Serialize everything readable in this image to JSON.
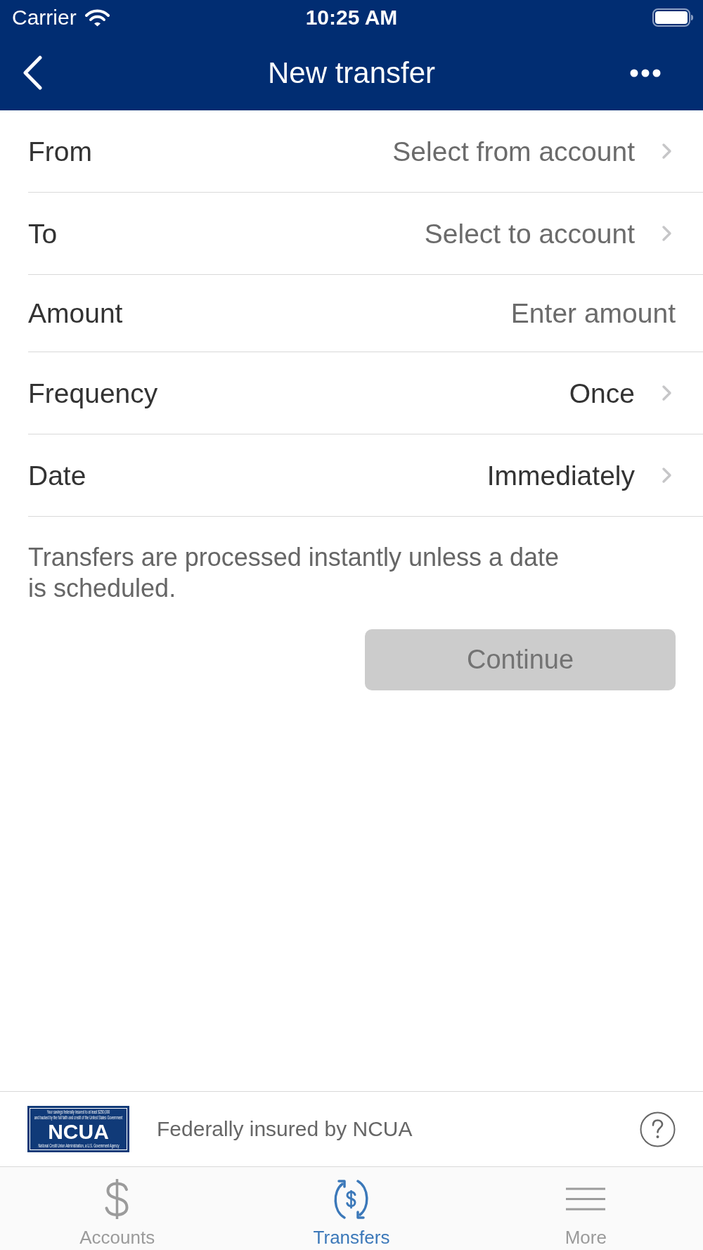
{
  "status_bar": {
    "carrier": "Carrier",
    "time": "10:25 AM"
  },
  "nav_bar": {
    "title": "New transfer"
  },
  "form": {
    "rows": [
      {
        "kind": "picker",
        "label": "From",
        "placeholder": "Select from account"
      },
      {
        "kind": "picker",
        "label": "To",
        "placeholder": "Select to account"
      },
      {
        "kind": "input",
        "label": "Amount",
        "placeholder": "Enter amount"
      },
      {
        "kind": "picker",
        "label": "Frequency",
        "value": "Once"
      },
      {
        "kind": "picker",
        "label": "Date",
        "value": "Immediately"
      }
    ]
  },
  "note": "Transfers are processed instantly unless a date is scheduled.",
  "continue_button": {
    "label": "Continue",
    "disabled": true
  },
  "footer": {
    "logo": {
      "top_lines": [
        "Your savings federally insured to at least $250,000",
        "and backed by the full faith and credit of the United States Government"
      ],
      "wordmark": "NCUA",
      "bottom_line": "National Credit Union Administration, a U.S. Government Agency"
    },
    "text": "Federally insured by NCUA"
  },
  "tab_bar": {
    "tabs": [
      {
        "kind": "dollar",
        "label": "Accounts",
        "selected": false
      },
      {
        "kind": "transfer",
        "label": "Transfers",
        "selected": true
      },
      {
        "kind": "menu",
        "label": "More",
        "selected": false
      }
    ]
  }
}
